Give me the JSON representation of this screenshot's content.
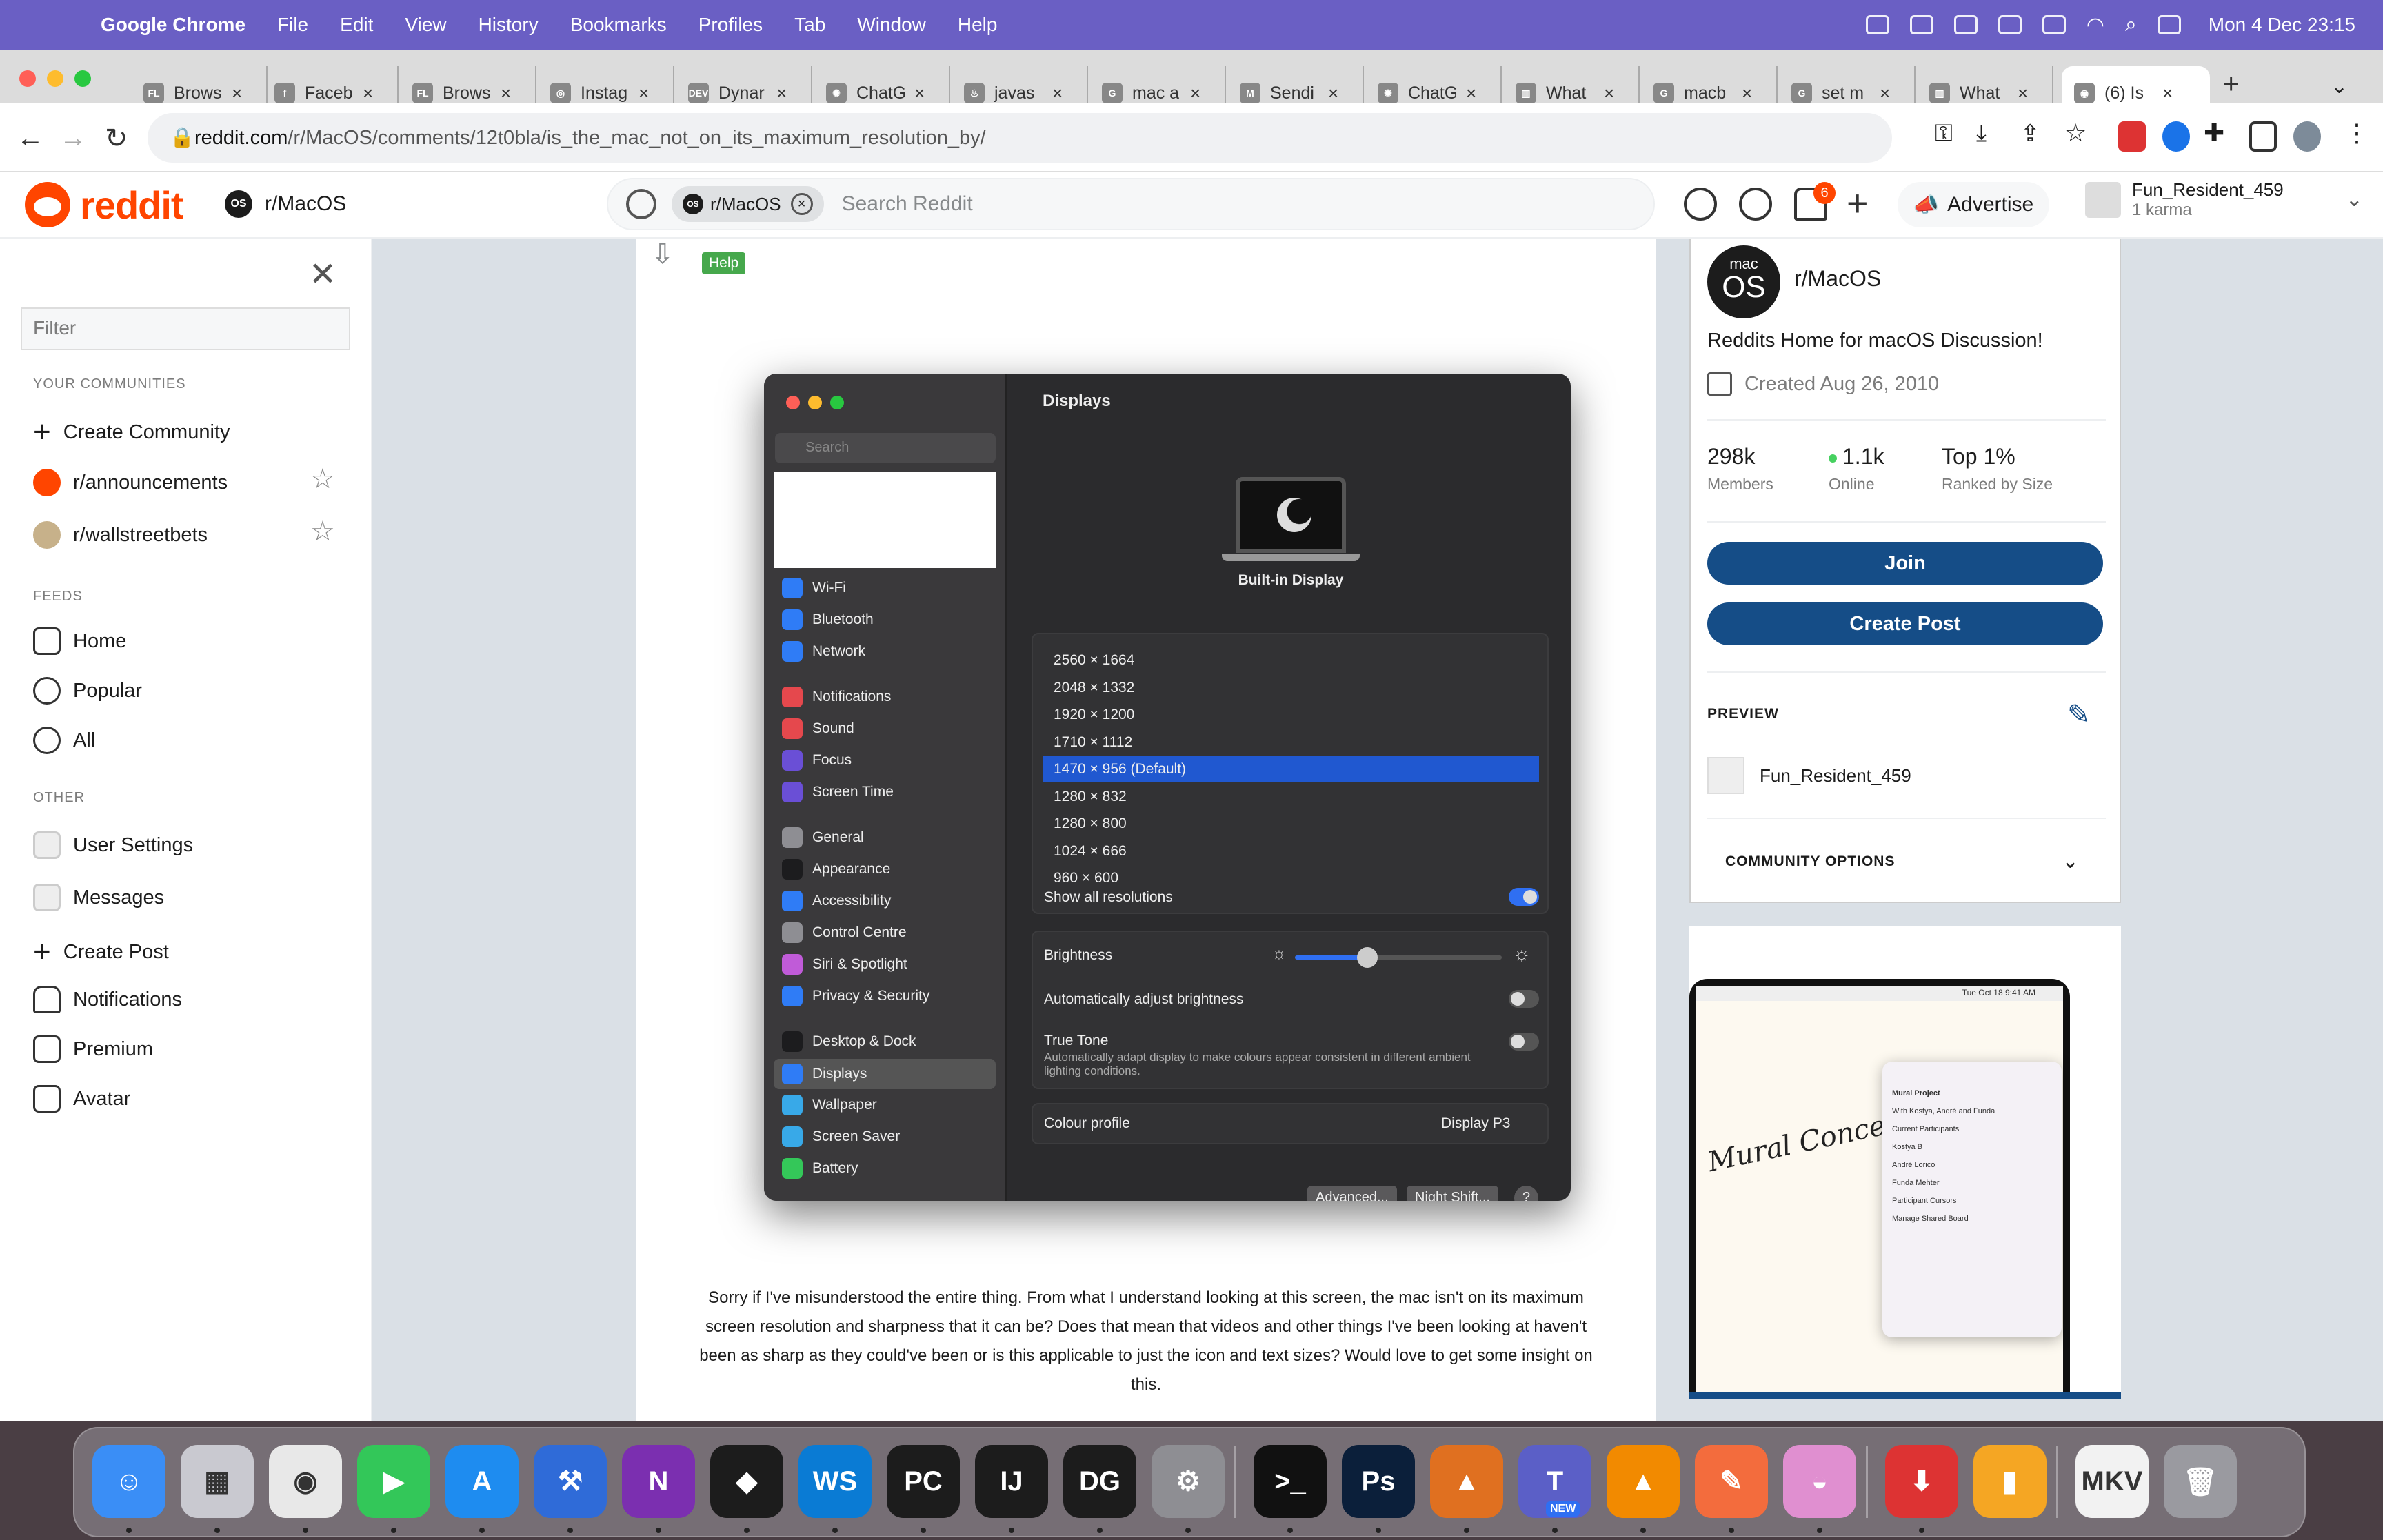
{
  "menubar": {
    "app": "Google Chrome",
    "items": [
      "File",
      "Edit",
      "View",
      "History",
      "Bookmarks",
      "Profiles",
      "Tab",
      "Window",
      "Help"
    ],
    "clock": "Mon 4 Dec  23:15"
  },
  "tabs": [
    {
      "title": "Brows",
      "fav": "FL"
    },
    {
      "title": "Faceb",
      "fav": "f"
    },
    {
      "title": "Brows",
      "fav": "FL"
    },
    {
      "title": "Instag",
      "fav": "◎"
    },
    {
      "title": "Dynar",
      "fav": "DEV"
    },
    {
      "title": "ChatG",
      "fav": "✺"
    },
    {
      "title": "javas",
      "fav": "♨"
    },
    {
      "title": "mac a",
      "fav": "G"
    },
    {
      "title": "Sendi",
      "fav": "M"
    },
    {
      "title": "ChatG",
      "fav": "✺"
    },
    {
      "title": "What",
      "fav": "▥"
    },
    {
      "title": "macb",
      "fav": "G"
    },
    {
      "title": "set m",
      "fav": "G"
    },
    {
      "title": "What",
      "fav": "▥"
    },
    {
      "title": "(6) Is",
      "fav": "◉"
    }
  ],
  "address": {
    "domain": "reddit.com",
    "path": "/r/MacOS/comments/12t0bla/is_the_mac_not_on_its_maximum_resolution_by/"
  },
  "reddit_header": {
    "logo_text": "reddit",
    "subreddit": "r/MacOS",
    "os_badge": "OS",
    "search_chip": "r/MacOS",
    "search_placeholder": "Search Reddit",
    "notification_count": "6",
    "advertise": "Advertise",
    "username": "Fun_Resident_459",
    "karma": "1 karma"
  },
  "sidebar": {
    "filter_placeholder": "Filter",
    "your_communities": "YOUR COMMUNITIES",
    "create_community": "Create Community",
    "communities": [
      "r/announcements",
      "r/wallstreetbets"
    ],
    "feeds_title": "FEEDS",
    "feeds": [
      "Home",
      "Popular",
      "All"
    ],
    "other_title": "OTHER",
    "other": [
      "User Settings",
      "Messages",
      "Create Post",
      "Notifications",
      "Premium",
      "Avatar"
    ]
  },
  "post": {
    "flair": "Help",
    "body": "Sorry if I've misunderstood the entire thing. From what I understand looking at this screen, the mac isn't on its maximum screen resolution and sharpness that it can be? Does that mean that videos and other things I've been looking at haven't been as sharp as they could've been or is this applicable to just the icon and text sizes? Would love to get some insight on this."
  },
  "settings_shot": {
    "search": "Search",
    "title": "Displays",
    "display_name": "Built-in Display",
    "groups": [
      [
        "Wi-Fi",
        "Bluetooth",
        "Network"
      ],
      [
        "Notifications",
        "Sound",
        "Focus",
        "Screen Time"
      ],
      [
        "General",
        "Appearance",
        "Accessibility",
        "Control Centre",
        "Siri & Spotlight",
        "Privacy & Security"
      ],
      [
        "Desktop & Dock",
        "Displays",
        "Wallpaper",
        "Screen Saver",
        "Battery"
      ]
    ],
    "icon_colors": [
      "#2f7cf6",
      "#2f7cf6",
      "#2f7cf6",
      "#e5484d",
      "#e5484d",
      "#6a4fd6",
      "#6a4fd6",
      "#8e8e93",
      "#1c1c1e",
      "#2f7cf6",
      "#8e8e93",
      "#c05bd8",
      "#2f7cf6",
      "#1c1c1e",
      "#2f7cf6",
      "#38a9e8",
      "#38a9e8",
      "#34c759"
    ],
    "resolutions": [
      "2560 × 1664",
      "2048 × 1332",
      "1920 × 1200",
      "1710 × 1112",
      "1470 × 956 (Default)",
      "1280 × 832",
      "1280 × 800",
      "1024 × 666",
      "960 × 600"
    ],
    "selected_resolution": 4,
    "show_all": "Show all resolutions",
    "brightness": "Brightness",
    "brightness_level": 0.35,
    "auto_brightness": "Automatically adjust brightness",
    "true_tone": "True Tone",
    "true_tone_desc": "Automatically adapt display to make colours appear consistent in different ambient lighting conditions.",
    "colour_profile": "Colour profile",
    "colour_profile_value": "Display P3",
    "advanced": "Advanced...",
    "night_shift": "Night Shift...",
    "help": "?"
  },
  "community": {
    "badge_top": "mac",
    "badge_bottom": "OS",
    "name": "r/MacOS",
    "description": "Reddits Home for macOS Discussion!",
    "created": "Created Aug 26, 2010",
    "stats": [
      {
        "value": "298k",
        "label": "Members"
      },
      {
        "value": "1.1k",
        "label": "Online"
      },
      {
        "value": "Top 1%",
        "label": "Ranked by Size"
      }
    ],
    "join": "Join",
    "create_post": "Create Post",
    "preview": "PREVIEW",
    "preview_user": "Fun_Resident_459",
    "options": "COMMUNITY OPTIONS"
  },
  "ad": {
    "menubar_time": "Tue Oct 18  9:41 AM",
    "mural": "Mural Concepts",
    "facetime_title": "Mural Project",
    "facetime_sub": "With Kostya, André and Funda",
    "participants": [
      "Kostya B",
      "André Lorico",
      "Funda Mehter"
    ],
    "current_participants": "Current Participants",
    "cursors": "Participant Cursors",
    "shared": "Manage Shared Board"
  },
  "dock": [
    {
      "name": "Finder",
      "color": "#3a8ef6",
      "glyph": "☺"
    },
    {
      "name": "Launchpad",
      "color": "#c9c9d0",
      "glyph": "▦"
    },
    {
      "name": "Chrome",
      "color": "#e8e8e8",
      "glyph": "◉"
    },
    {
      "name": "FaceTime",
      "color": "#33c759",
      "glyph": "▶"
    },
    {
      "name": "App Store",
      "color": "#1e8cf0",
      "glyph": "A"
    },
    {
      "name": "Xcode",
      "color": "#2f6bd8",
      "glyph": "⚒"
    },
    {
      "name": "OneNote",
      "color": "#7b2fb0",
      "glyph": "N"
    },
    {
      "name": "JetBrains",
      "color": "#1c1c1c",
      "glyph": "◆"
    },
    {
      "name": "WebStorm",
      "color": "#0a7bd4",
      "glyph": "WS"
    },
    {
      "name": "PyCharm",
      "color": "#1c1c1c",
      "glyph": "PC"
    },
    {
      "name": "IntelliJ",
      "color": "#1c1c1c",
      "glyph": "IJ"
    },
    {
      "name": "DataGrip",
      "color": "#1c1c1c",
      "glyph": "DG"
    },
    {
      "name": "System Settings",
      "color": "#8e8e93",
      "glyph": "⚙"
    },
    {
      "name": "Terminal",
      "color": "#111",
      "glyph": ">_"
    },
    {
      "name": "Photoshop",
      "color": "#0b1f3a",
      "glyph": "Ps"
    },
    {
      "name": "MATLAB",
      "color": "#e07020",
      "glyph": "▲"
    },
    {
      "name": "Teams",
      "color": "#5b5fc7",
      "glyph": "T"
    },
    {
      "name": "VLC",
      "color": "#f28a00",
      "glyph": "▲"
    },
    {
      "name": "Vectornator",
      "color": "#f36c3d",
      "glyph": "✎"
    },
    {
      "name": "CleanMyMac",
      "color": "#e08fd0",
      "glyph": "◒"
    },
    {
      "name": "Downloads",
      "color": "#d33",
      "glyph": "⬇"
    },
    {
      "name": "Books",
      "color": "#f5a623",
      "glyph": "▮"
    },
    {
      "name": "MKV",
      "color": "#f2f2f2",
      "glyph": "MKV"
    },
    {
      "name": "Trash",
      "color": "#9a9aa0",
      "glyph": "🗑"
    }
  ],
  "dock_teams_badge": "NEW"
}
